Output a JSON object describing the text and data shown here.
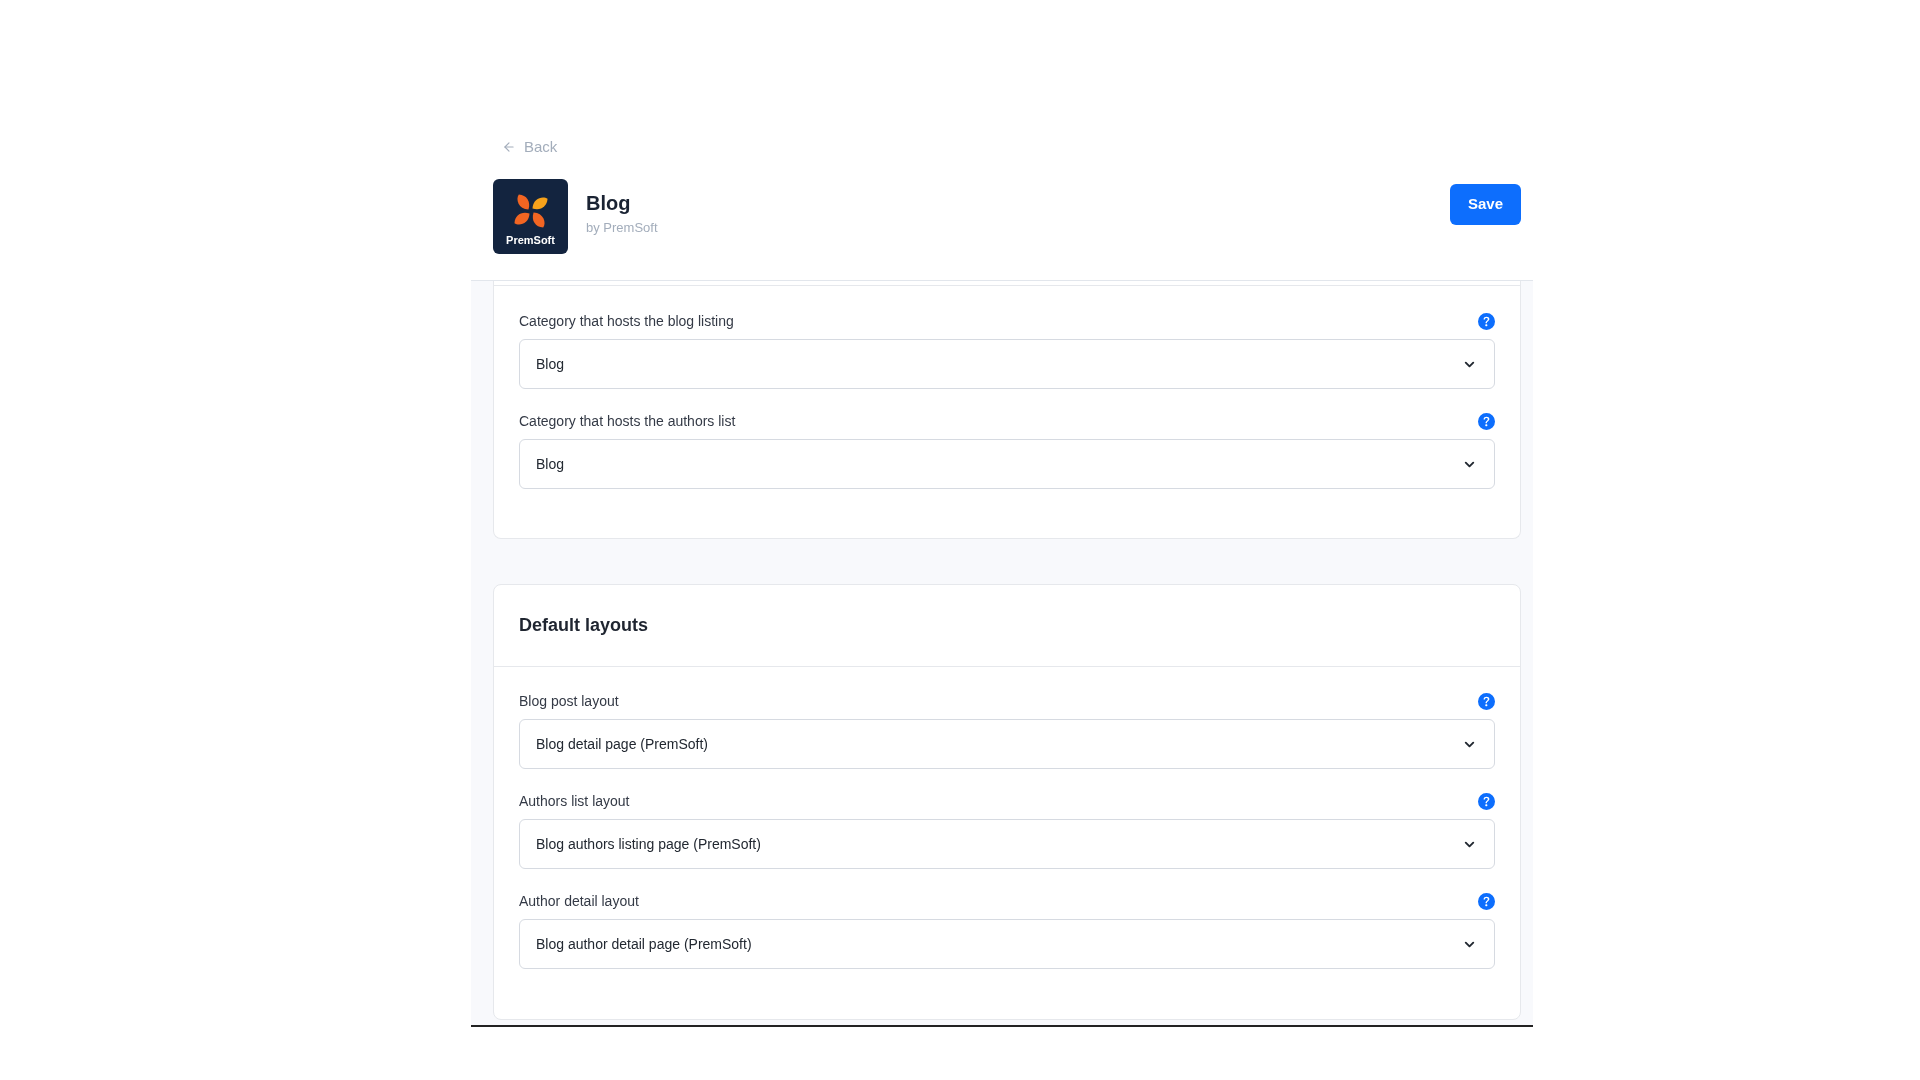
{
  "back_link": {
    "label": "Back"
  },
  "app": {
    "title": "Blog",
    "vendor": "by PremSoft",
    "logo_text": "PremSoft"
  },
  "save_button": {
    "label": "Save"
  },
  "sections": [
    {
      "fields": [
        {
          "label": "Category that hosts the blog listing",
          "value": "Blog"
        },
        {
          "label": "Category that hosts the authors list",
          "value": "Blog"
        }
      ]
    },
    {
      "title": "Default layouts",
      "fields": [
        {
          "label": "Blog post layout",
          "value": "Blog detail page (PremSoft)"
        },
        {
          "label": "Authors list layout",
          "value": "Blog authors listing page (PremSoft)"
        },
        {
          "label": "Author detail layout",
          "value": "Blog author detail page (PremSoft)"
        }
      ]
    }
  ]
}
